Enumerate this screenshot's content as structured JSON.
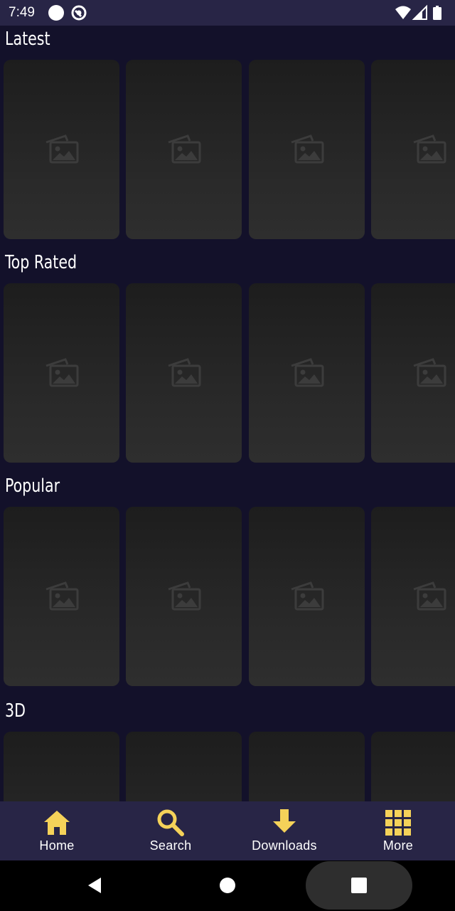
{
  "status_bar": {
    "time": "7:49"
  },
  "sections": [
    {
      "title": "Latest"
    },
    {
      "title": "Top Rated"
    },
    {
      "title": "Popular"
    },
    {
      "title": "3D"
    }
  ],
  "bottom_nav": {
    "items": [
      {
        "label": "Home",
        "icon": "home-icon"
      },
      {
        "label": "Search",
        "icon": "search-icon"
      },
      {
        "label": "Downloads",
        "icon": "download-icon"
      },
      {
        "label": "More",
        "icon": "grid-icon"
      }
    ],
    "accent_color": "#f5d259"
  },
  "colors": {
    "background": "#13112a",
    "bar": "#282546",
    "card": "#262626"
  }
}
